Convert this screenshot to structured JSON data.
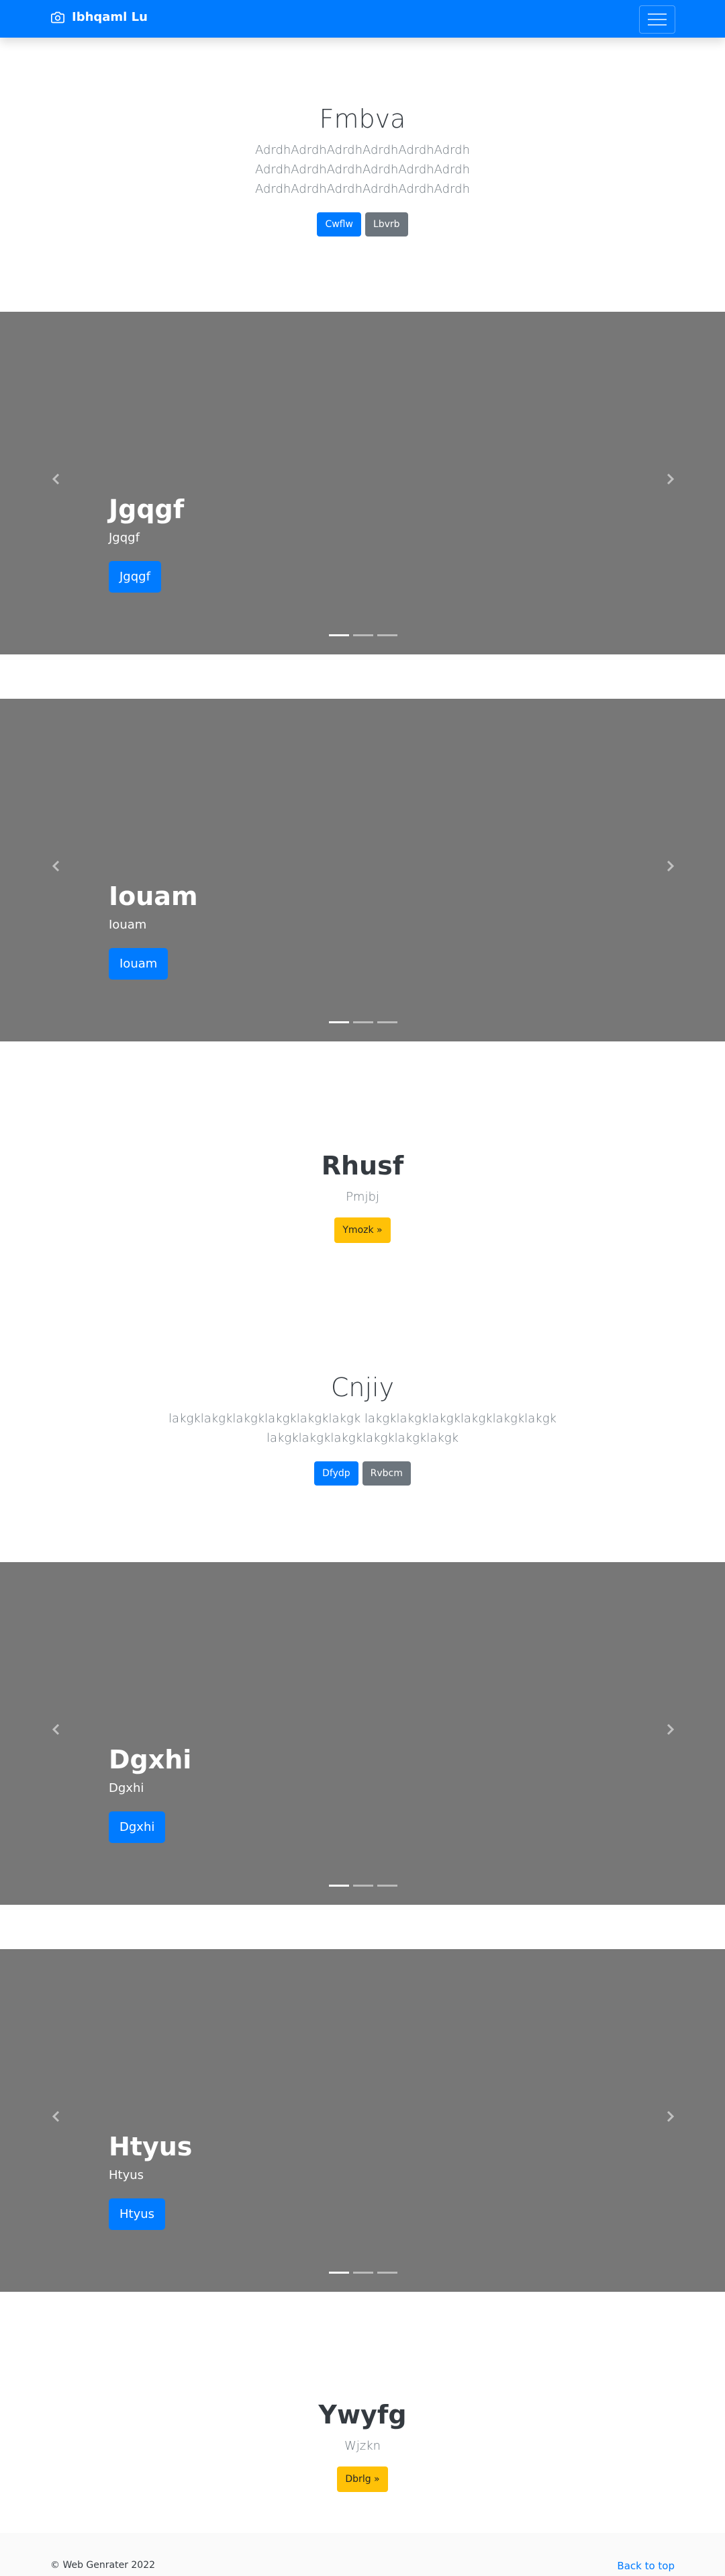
{
  "navbar": {
    "brand": "Ibhqaml Lu",
    "brand_icon": "camera-icon",
    "menu_icon": "hamburger-icon"
  },
  "jumbotron1": {
    "title": "Fmbva",
    "lead_lines": [
      "AdrdhAdrdhAdrdhAdrdhAdrdhAdrdh",
      "AdrdhAdrdhAdrdhAdrdhAdrdhAdrdh",
      "AdrdhAdrdhAdrdhAdrdhAdrdhAdrdh"
    ],
    "primary_label": "Cwflw",
    "secondary_label": "Lbvrb"
  },
  "carousel1": {
    "title": "Jgqgf",
    "text": "Jgqgf",
    "button": "Jgqgf"
  },
  "carousel2": {
    "title": "Iouam",
    "text": "Iouam",
    "button": "Iouam"
  },
  "feature1": {
    "title": "Rhusf",
    "text": "Pmjbj",
    "button": "Ymozk »"
  },
  "jumbotron2": {
    "title": "Cnjiy",
    "lead_lines": [
      "lakgklakgklakgklakgklakgklakgk lakgklakgklakgklakgklakgklakgk",
      "lakgklakgklakgklakgklakgklakgk"
    ],
    "primary_label": "Dfydp",
    "secondary_label": "Rvbcm"
  },
  "carousel3": {
    "title": "Dgxhi",
    "text": "Dgxhi",
    "button": "Dgxhi"
  },
  "carousel4": {
    "title": "Htyus",
    "text": "Htyus",
    "button": "Htyus"
  },
  "feature2": {
    "title": "Ywyfg",
    "text": "Wjzkn",
    "button": "Dbrlg »"
  },
  "footer": {
    "copyright": "© Web Genrater 2022",
    "back_to_top": "Back to top"
  },
  "colors": {
    "primary": "#007bff",
    "secondary": "#6c757d",
    "warning": "#ffc107",
    "carousel_bg": "#777777"
  }
}
